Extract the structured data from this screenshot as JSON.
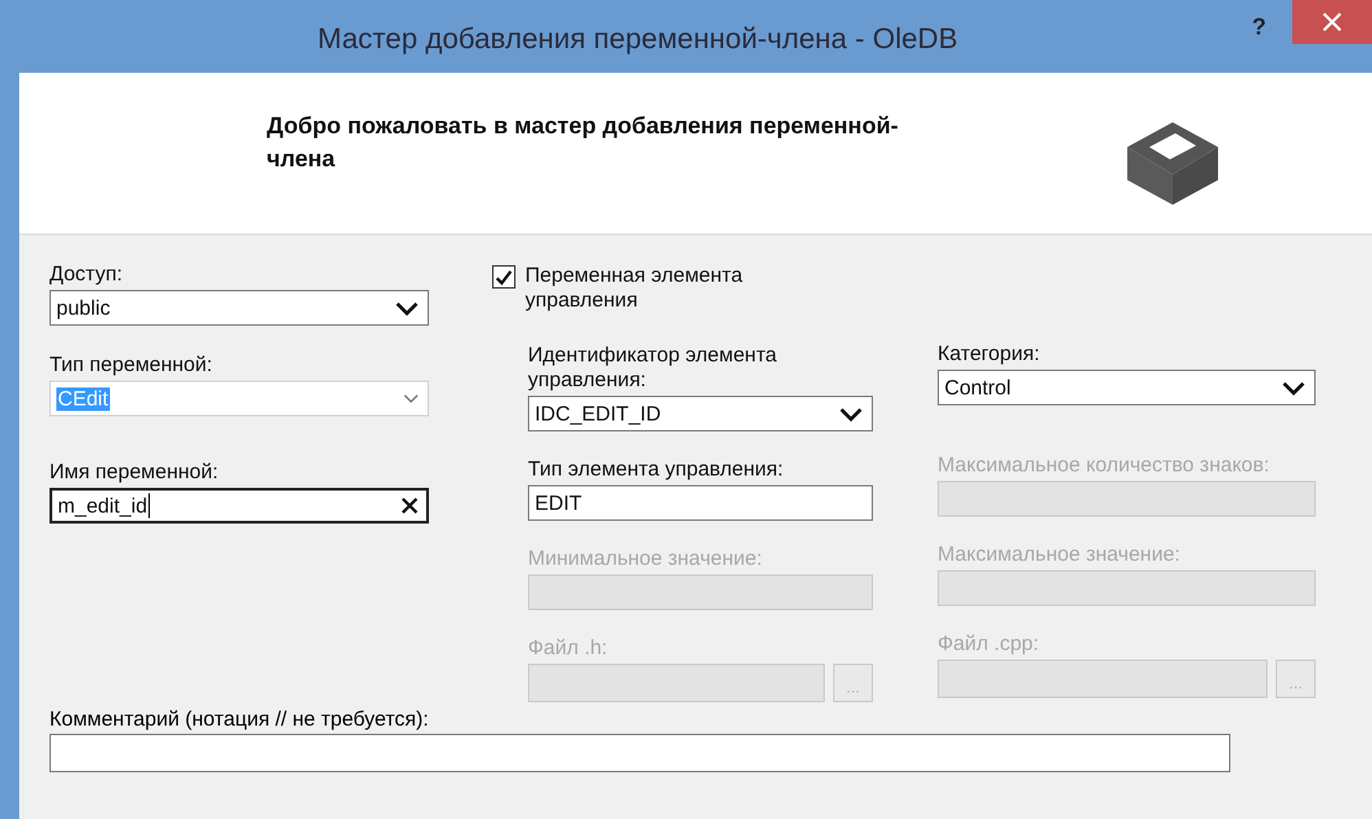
{
  "window": {
    "title": "Мастер добавления переменной-члена - OleDB",
    "help_button": "?"
  },
  "header": {
    "heading": "Добро пожаловать в мастер добавления переменной-члена"
  },
  "columns": [
    {
      "fields": [
        {
          "kind": "combo",
          "label": "Доступ:",
          "value": "public",
          "disabled": false,
          "focused": false
        },
        {
          "kind": "editable_combo",
          "label": "Тип переменной:",
          "value": "CEdit",
          "disabled": false,
          "focused": true
        },
        {
          "kind": "text",
          "label": "Имя переменной:",
          "value": "m_edit_id",
          "disabled": false,
          "focused": true
        }
      ]
    },
    {
      "fields": [
        {
          "kind": "checkbox",
          "label": "Переменная элемента управления",
          "checked": true,
          "disabled": false,
          "focused": false
        },
        {
          "kind": "combo",
          "label": "Идентификатор элемента управления:",
          "value": "IDC_EDIT_ID",
          "disabled": false,
          "focused": false
        },
        {
          "kind": "text",
          "label": "Тип элемента управления:",
          "value": "EDIT",
          "disabled": false,
          "focused": false
        },
        {
          "kind": "text",
          "label": "Минимальное значение:",
          "disabled": true,
          "focused": false
        },
        {
          "kind": "file",
          "label": "Файл .h:",
          "browse": "...",
          "disabled": true,
          "focused": false
        }
      ]
    },
    {
      "fields": [
        {
          "kind": "combo",
          "label": "Категория:",
          "value": "Control",
          "disabled": false,
          "focused": false
        },
        {
          "kind": "text",
          "label": "Максимальное количество знаков:",
          "disabled": true,
          "focused": false
        },
        {
          "kind": "text",
          "label": "Максимальное значение:",
          "disabled": true,
          "focused": false
        },
        {
          "kind": "file",
          "label": "Файл .cpp:",
          "browse": "...",
          "disabled": true,
          "focused": false
        }
      ]
    }
  ],
  "comment": {
    "label": "Комментарий (нотация // не требуется):"
  }
}
